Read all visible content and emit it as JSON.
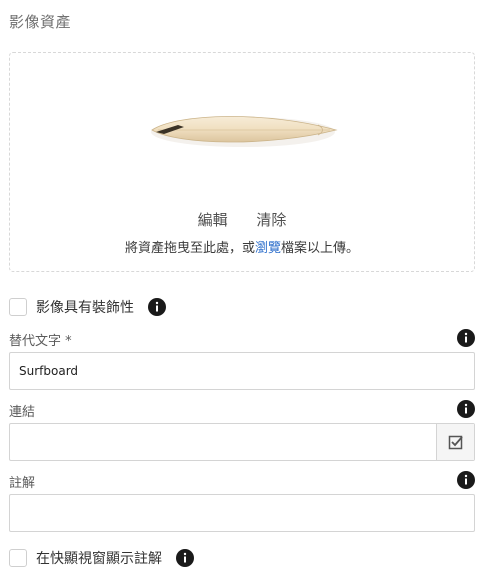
{
  "section": {
    "title": "影像資產"
  },
  "asset": {
    "thumbnail_icon": "surfboard-thumbnail",
    "edit_label": "編輯",
    "clear_label": "清除",
    "hint_before": "將資產拖曳至此處，或",
    "hint_link": "瀏覽",
    "hint_after": "檔案以上傳。"
  },
  "decorative": {
    "label": "影像具有裝飾性",
    "checked": false
  },
  "alt_text": {
    "label": "替代文字 *",
    "value": "Surfboard",
    "placeholder": ""
  },
  "link": {
    "label": "連結",
    "value": "",
    "picker_icon": "checkbox-picker-icon"
  },
  "caption": {
    "label": "註解",
    "value": ""
  },
  "popup_caption": {
    "label": "在快顯視窗顯示註解",
    "checked": false
  },
  "colors": {
    "accent_link": "#2c6ecb",
    "info_icon": "#1a1a1a",
    "border": "#d4d4d4"
  }
}
